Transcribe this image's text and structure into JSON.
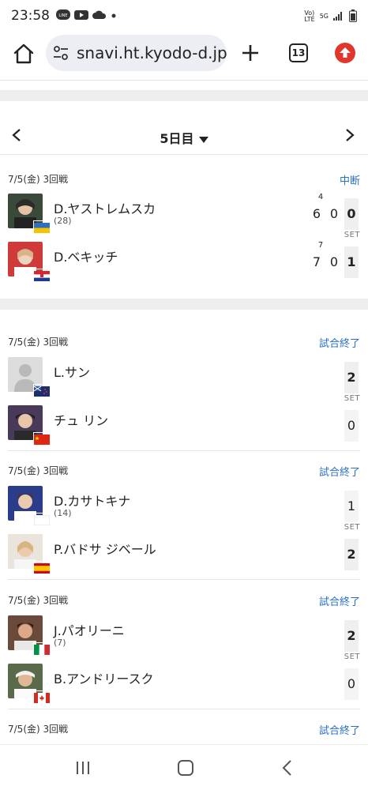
{
  "status_bar": {
    "time": "23:58",
    "icons": [
      "line-icon",
      "youtube-icon",
      "cloud-icon",
      "dot-icon"
    ],
    "network_lines": [
      "Vo)",
      "LTE",
      "5G"
    ]
  },
  "browser": {
    "url": "snavi.ht.kyodo-d.jp",
    "tab_count": "13"
  },
  "day_nav": {
    "day_label": "5日目"
  },
  "labels": {
    "set": "SET"
  },
  "matches": [
    {
      "header": "7/5(金) 3回戦",
      "status": "中断",
      "players": [
        {
          "name": "D.ヤストレムスカ",
          "seed": "(28)",
          "flag": "Ukraine",
          "scores": [
            "6",
            "0"
          ],
          "tiebreak": "4",
          "set": "0"
        },
        {
          "name": "D.ベキッチ",
          "seed": "",
          "flag": "Croatia",
          "scores": [
            "7",
            "0"
          ],
          "tiebreak": "7",
          "set": "1"
        }
      ]
    },
    {
      "header": "7/5(金) 3回戦",
      "status": "試合終了",
      "players": [
        {
          "name": "L.サン",
          "seed": "",
          "flag": "New Zealand",
          "set": "2"
        },
        {
          "name": "チュ リン",
          "seed": "",
          "flag": "China",
          "set": "0"
        }
      ]
    },
    {
      "header": "7/5(金) 3回戦",
      "status": "試合終了",
      "players": [
        {
          "name": "D.カサトキナ",
          "seed": "(14)",
          "flag": "Neutral",
          "set": "1"
        },
        {
          "name": "P.バドサ ジベール",
          "seed": "",
          "flag": "Spain",
          "set": "2"
        }
      ]
    },
    {
      "header": "7/5(金) 3回戦",
      "status": "試合終了",
      "players": [
        {
          "name": "J.パオリーニ",
          "seed": "(7)",
          "flag": "Italy",
          "set": "2"
        },
        {
          "name": "B.アンドリースク",
          "seed": "",
          "flag": "Canada",
          "set": "0"
        }
      ]
    },
    {
      "header": "7/5(金) 3回戦",
      "status": "試合終了",
      "players": []
    }
  ],
  "colors": {
    "link_blue": "#2a6fc4",
    "set_bg": "#efefef",
    "update_red": "#e0362c"
  }
}
